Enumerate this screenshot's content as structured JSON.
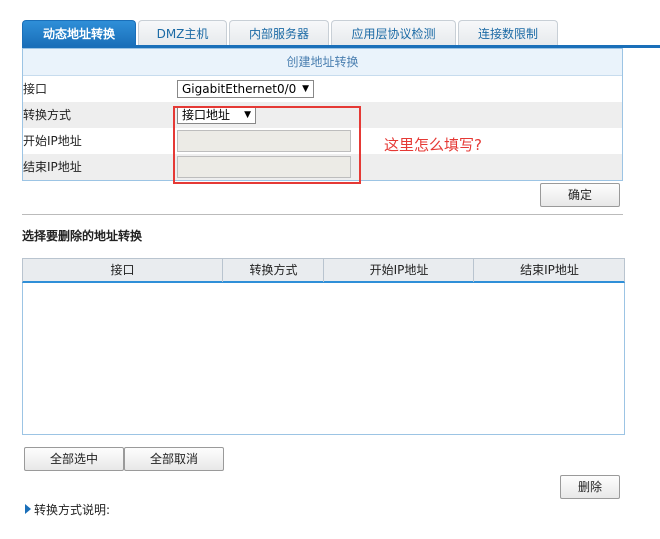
{
  "tabs": [
    {
      "label": "动态地址转换",
      "active": true
    },
    {
      "label": "DMZ主机",
      "active": false
    },
    {
      "label": "内部服务器",
      "active": false
    },
    {
      "label": "应用层协议检测",
      "active": false
    },
    {
      "label": "连接数限制",
      "active": false
    }
  ],
  "form": {
    "title": "创建地址转换",
    "interface_label": "接口",
    "interface_value": "GigabitEthernet0/0",
    "mode_label": "转换方式",
    "mode_value": "接口地址",
    "start_ip_label": "开始IP地址",
    "end_ip_label": "结束IP地址",
    "confirm_button": "确定"
  },
  "annotation": "这里怎么填写?",
  "delete_section": {
    "title": "选择要删除的地址转换",
    "columns": [
      "接口",
      "转换方式",
      "开始IP地址",
      "结束IP地址"
    ],
    "select_all_button": "全部选中",
    "cancel_all_button": "全部取消",
    "delete_button": "删除"
  },
  "footer_note": "转换方式说明:",
  "colors": {
    "accent": "#1a6fb9",
    "annotation": "#e53935"
  }
}
